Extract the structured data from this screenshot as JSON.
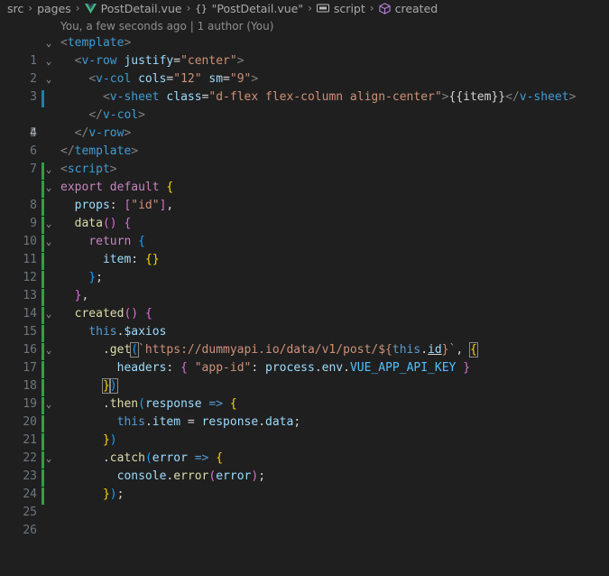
{
  "breadcrumb": {
    "items": [
      "src",
      "pages",
      "PostDetail.vue",
      "\"PostDetail.vue\"",
      "script",
      "created"
    ],
    "separator": ">"
  },
  "blame": "You, a few seconds ago | 1 author (You)",
  "editor": {
    "active_line": 4,
    "line_numbers": [
      "1",
      "2",
      "3",
      "4",
      "5",
      "6",
      "7",
      "8",
      "9",
      "10",
      "11",
      "12",
      "13",
      "14",
      "15",
      "16",
      "17",
      "18",
      "19",
      "20",
      "21",
      "22",
      "23",
      "24",
      "25",
      "26"
    ],
    "tokens": {
      "template": "template",
      "v_row": "v-row",
      "justify": "justify",
      "center_str": "\"center\"",
      "v_col": "v-col",
      "cols": "cols",
      "cols_val": "\"12\"",
      "sm": "sm",
      "sm_val": "\"9\"",
      "v_sheet": "v-sheet",
      "class_attr": "class",
      "class_val": "\"d-flex flex-column align-center\"",
      "item_interp": "{{item}}",
      "script": "script",
      "export_kw": "export",
      "default_kw": "default",
      "props": "props",
      "id_str": "\"id\"",
      "data_fn": "data",
      "return_kw": "return",
      "item_key": "item",
      "created_fn": "created",
      "this_kw": "this",
      "axios_prop": "$axios",
      "get_fn": "get",
      "url_str": "`https://dummyapi.io/data/v1/post/${",
      "url_this": "this",
      "url_id": "id",
      "url_end": "}`",
      "headers": "headers",
      "app_id_str": "\"app-id\"",
      "process": "process",
      "env": "env",
      "api_key": "VUE_APP_API_KEY",
      "then_fn": "then",
      "response": "response",
      "item_prop": "item",
      "data_prop": "data",
      "catch_fn": "catch",
      "error": "error",
      "console": "console",
      "error_fn": "error"
    }
  },
  "colors": {
    "background": "#1f1f1f",
    "gutter_added": "#2ea043",
    "gutter_modified": "#1b81a8"
  }
}
